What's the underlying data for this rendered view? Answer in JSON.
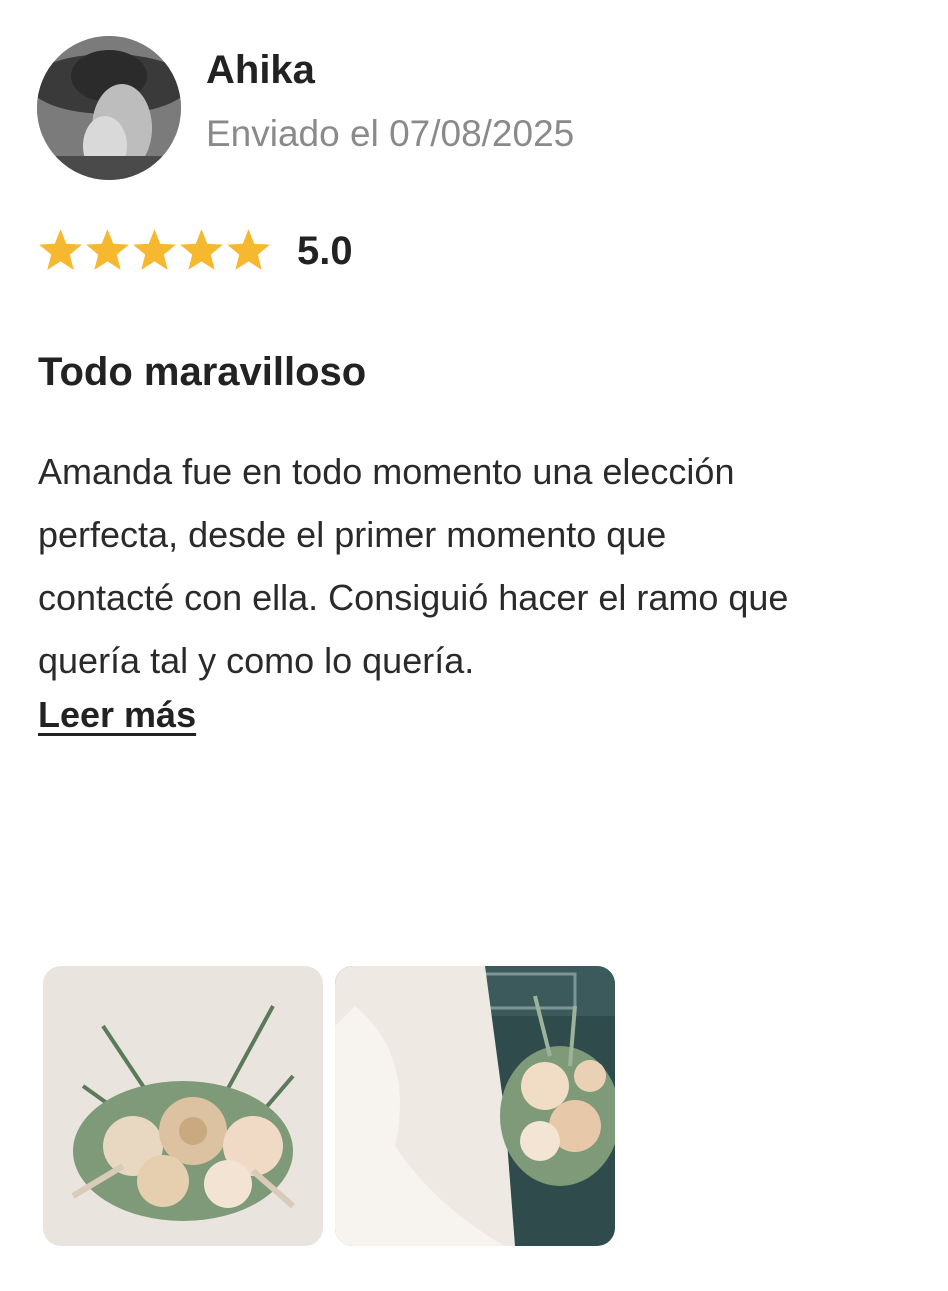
{
  "reviewer": {
    "name": "Ahika",
    "sent_date": "Enviado el 07/08/2025",
    "avatar_icon": "avatar-photo"
  },
  "rating": {
    "value": 5.0,
    "label": "5.0",
    "max": 5,
    "star_color": "#f5b82e"
  },
  "review": {
    "title": "Todo maravilloso",
    "lines": [
      "Amanda fue en todo momento una elección",
      "perfecta, desde el primer momento que",
      "contacté con ella. Consiguió hacer el ramo que",
      "quería tal y como lo quería."
    ],
    "read_more_label": "Leer más"
  },
  "photos": [
    {
      "icon": "bouquet-photo"
    },
    {
      "icon": "bride-bouquet-photo"
    }
  ]
}
